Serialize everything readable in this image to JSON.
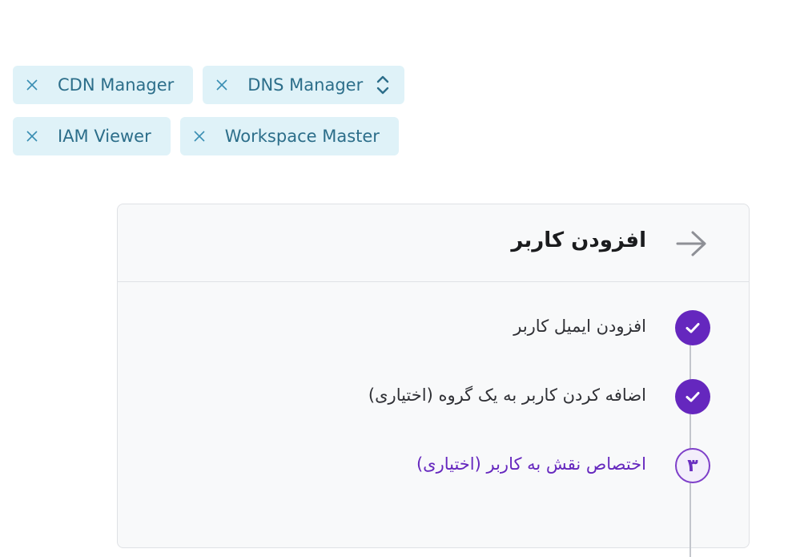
{
  "chips": [
    {
      "label": "CDN Manager"
    },
    {
      "label": "DNS Manager"
    },
    {
      "label": "IAM Viewer"
    },
    {
      "label": "Workspace Master"
    }
  ],
  "panel": {
    "title": "افزودن کاربر",
    "steps": [
      {
        "label": "افزودن ایمیل کاربر",
        "status": "done"
      },
      {
        "label": "اضافه کردن کاربر به یک گروه (اختیاری)",
        "status": "done"
      },
      {
        "label": "اختصاص نقش به کاربر (اختیاری)",
        "status": "current",
        "number": "۳"
      }
    ]
  },
  "colors": {
    "chip_bg": "#dff2f8",
    "chip_text": "#2c6e8a",
    "accent": "#6527be"
  }
}
